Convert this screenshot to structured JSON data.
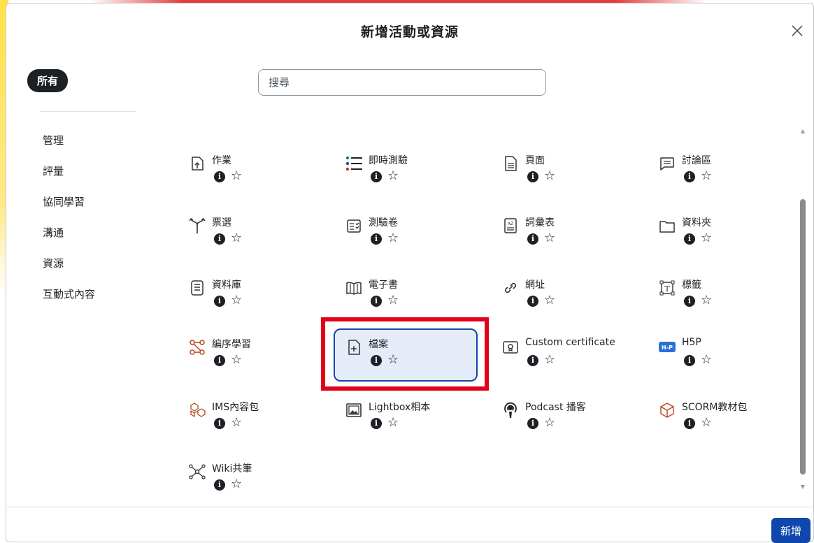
{
  "modal": {
    "title": "新增活動或資源"
  },
  "sidebar": {
    "all_label": "所有",
    "categories": [
      "管理",
      "評量",
      "協同學習",
      "溝通",
      "資源",
      "互動式內容"
    ]
  },
  "search": {
    "placeholder": "搜尋"
  },
  "items": [
    {
      "name": "作業",
      "icon": "assignment-upload-icon"
    },
    {
      "name": "即時測驗",
      "icon": "quiz-list-icon"
    },
    {
      "name": "頁面",
      "icon": "page-document-icon"
    },
    {
      "name": "討論區",
      "icon": "forum-chat-icon"
    },
    {
      "name": "票選",
      "icon": "choice-branch-icon"
    },
    {
      "name": "測驗卷",
      "icon": "survey-checklist-icon"
    },
    {
      "name": "詞彙表",
      "icon": "glossary-az-icon"
    },
    {
      "name": "資料夾",
      "icon": "folder-icon"
    },
    {
      "name": "資料庫",
      "icon": "database-icon"
    },
    {
      "name": "電子書",
      "icon": "book-icon"
    },
    {
      "name": "網址",
      "icon": "link-icon"
    },
    {
      "name": "標籤",
      "icon": "text-label-icon"
    },
    {
      "name": "編序學習",
      "icon": "lesson-flow-icon"
    },
    {
      "name": "檔案",
      "icon": "file-add-icon"
    },
    {
      "name": "Custom certificate",
      "icon": "certificate-icon"
    },
    {
      "name": "H5P",
      "icon": "h5p-icon"
    },
    {
      "name": "IMS內容包",
      "icon": "ims-package-icon"
    },
    {
      "name": "Lightbox相本",
      "icon": "image-gallery-icon"
    },
    {
      "name": "Podcast 播客",
      "icon": "podcast-icon"
    },
    {
      "name": "SCORM教材包",
      "icon": "scorm-package-icon"
    },
    {
      "name": "Wiki共筆",
      "icon": "wiki-network-icon"
    }
  ],
  "selected_item": "檔案",
  "info_glyph": "i",
  "star_glyph": "☆",
  "footer": {
    "add_label": "新增"
  },
  "colors": {
    "accent": "#0f47ad",
    "selected_bg": "#e6ecf7",
    "highlight": "#e4001a"
  }
}
